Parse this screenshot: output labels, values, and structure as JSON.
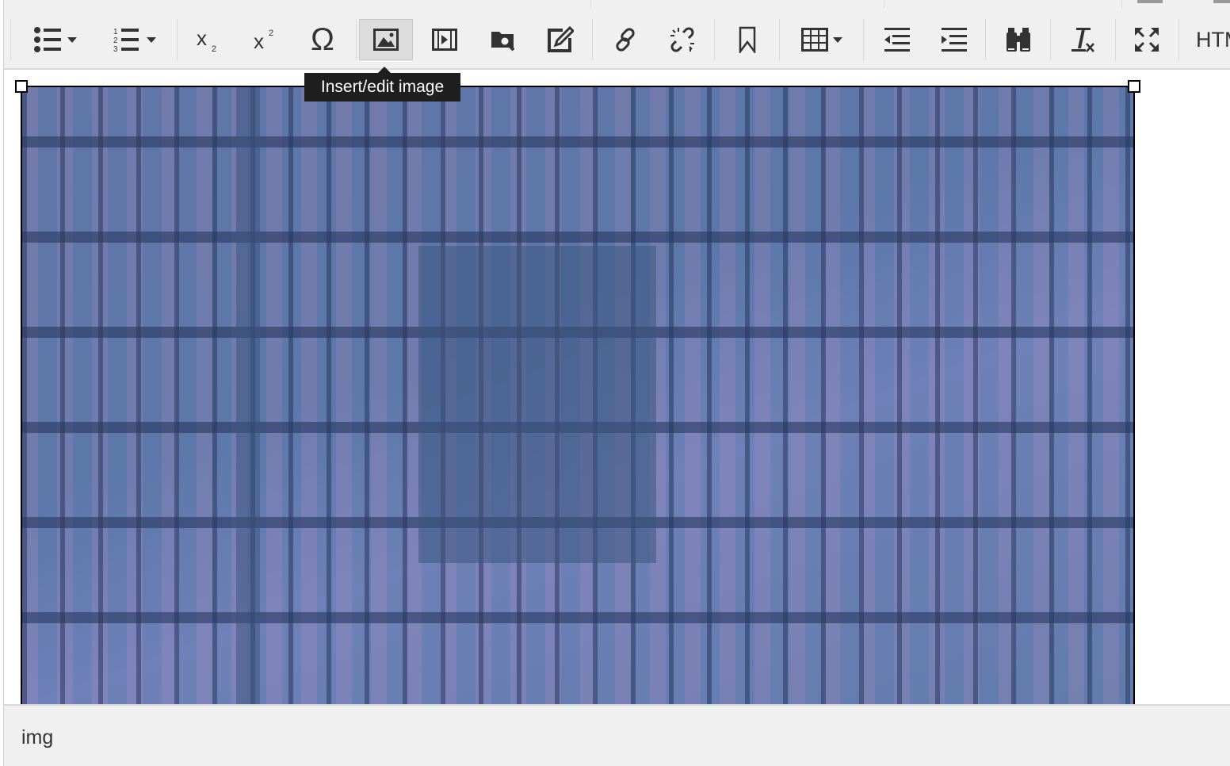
{
  "toolbar": {
    "buttons": [
      {
        "name": "bullet-list",
        "icon": "bullet-list-icon"
      },
      {
        "name": "numbered-list",
        "icon": "numbered-list-icon"
      },
      {
        "name": "subscript",
        "icon": "subscript-icon"
      },
      {
        "name": "superscript",
        "icon": "superscript-icon"
      },
      {
        "name": "special-character",
        "icon": "omega-icon"
      },
      {
        "name": "insert-image",
        "icon": "image-icon",
        "active": true
      },
      {
        "name": "insert-media",
        "icon": "film-icon"
      },
      {
        "name": "file-browser",
        "icon": "folder-search-icon"
      },
      {
        "name": "edit",
        "icon": "edit-icon"
      },
      {
        "name": "link",
        "icon": "link-icon"
      },
      {
        "name": "unlink",
        "icon": "unlink-icon"
      },
      {
        "name": "anchor",
        "icon": "bookmark-icon"
      },
      {
        "name": "table",
        "icon": "table-icon"
      },
      {
        "name": "outdent",
        "icon": "outdent-icon"
      },
      {
        "name": "indent",
        "icon": "indent-icon"
      },
      {
        "name": "find-replace",
        "icon": "binoculars-icon"
      },
      {
        "name": "clear-formatting",
        "icon": "clear-format-icon"
      },
      {
        "name": "fullscreen",
        "icon": "fullscreen-icon"
      }
    ],
    "html_label": "HTML",
    "tooltip": "Insert/edit image"
  },
  "statusbar": {
    "path": "img"
  },
  "colors": {
    "toolbar_bg": "#f0f0f0",
    "tooltip_bg": "#1f1f1f",
    "icon": "#333333"
  }
}
